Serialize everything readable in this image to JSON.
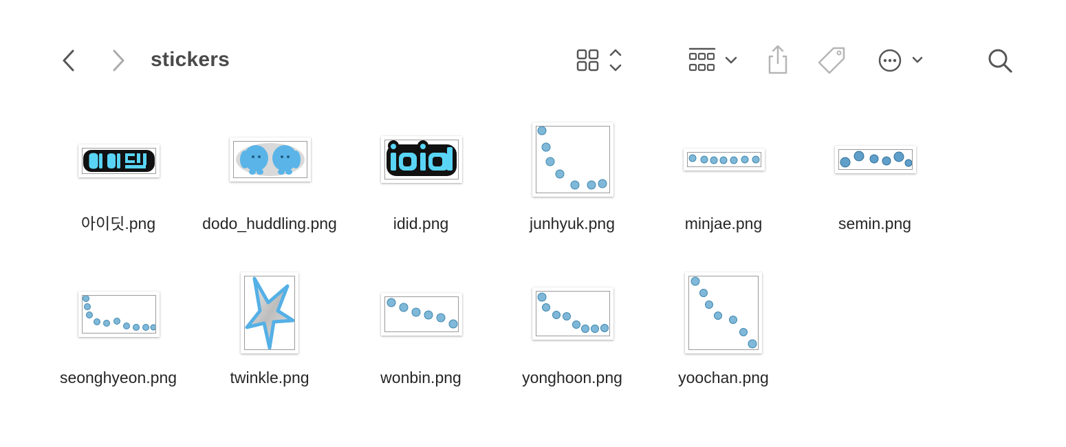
{
  "toolbar": {
    "title": "stickers",
    "back_icon": "chevron-left-icon",
    "forward_icon": "chevron-right-icon",
    "view_icon": "icon-grid-view-icon",
    "group_icon": "group-by-icon",
    "share_icon": "share-icon",
    "tag_icon": "tag-icon",
    "more_icon": "ellipsis-circle-icon",
    "search_icon": "search-icon"
  },
  "files": [
    {
      "name": "아이딧.png",
      "thumb": "aidit"
    },
    {
      "name": "dodo_huddling.png",
      "thumb": "dodo"
    },
    {
      "name": "idid.png",
      "thumb": "idid"
    },
    {
      "name": "junhyuk.png",
      "thumb": "dots-square"
    },
    {
      "name": "minjae.png",
      "thumb": "dots-row"
    },
    {
      "name": "semin.png",
      "thumb": "dots-row2"
    },
    {
      "name": "seonghyeon.png",
      "thumb": "dots-curve"
    },
    {
      "name": "twinkle.png",
      "thumb": "star"
    },
    {
      "name": "wonbin.png",
      "thumb": "dots-diag"
    },
    {
      "name": "yonghoon.png",
      "thumb": "dots-curve2"
    },
    {
      "name": "yoochan.png",
      "thumb": "dots-diag2"
    }
  ],
  "colors": {
    "accent_blue": "#5ac8fa",
    "sticker_black": "#111111",
    "bubble_blue": "#7fb8d8"
  }
}
